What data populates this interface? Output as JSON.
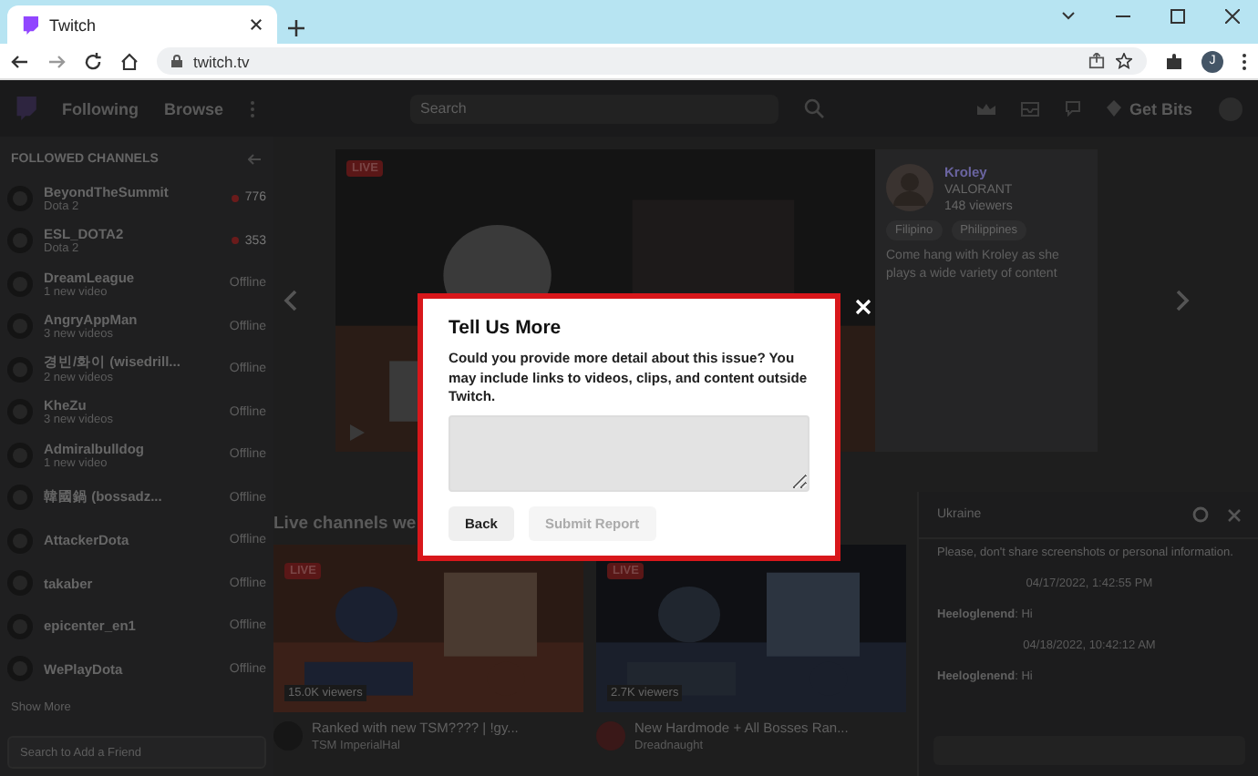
{
  "browser": {
    "tab_title": "Twitch",
    "url": "twitch.tv",
    "avatar_letter": "J"
  },
  "nav": {
    "links": [
      "Following",
      "Browse"
    ],
    "search_placeholder": "Search",
    "get_bits": "Get Bits"
  },
  "sidebar": {
    "heading": "FOLLOWED CHANNELS",
    "channels": [
      {
        "name": "BeyondTheSummit",
        "subtitle": "Dota 2",
        "status": "776",
        "live": true
      },
      {
        "name": "ESL_DOTA2",
        "subtitle": "Dota 2",
        "status": "353",
        "live": true
      },
      {
        "name": "DreamLeague",
        "subtitle": "1 new video",
        "status": "Offline",
        "live": false
      },
      {
        "name": "AngryAppMan",
        "subtitle": "3 new videos",
        "status": "Offline",
        "live": false
      },
      {
        "name": "경빈/화이 (wisedrill...",
        "subtitle": "2 new videos",
        "status": "Offline",
        "live": false
      },
      {
        "name": "KheZu",
        "subtitle": "3 new videos",
        "status": "Offline",
        "live": false
      },
      {
        "name": "Admiralbulldog",
        "subtitle": "1 new video",
        "status": "Offline",
        "live": false
      },
      {
        "name": "韓國鍋 (bossadz...",
        "status": "Offline",
        "live": false
      },
      {
        "name": "AttackerDota",
        "status": "Offline",
        "live": false
      },
      {
        "name": "takaber",
        "status": "Offline",
        "live": false
      },
      {
        "name": "epicenter_en1",
        "status": "Offline",
        "live": false
      },
      {
        "name": "WePlayDota",
        "status": "Offline",
        "live": false
      }
    ],
    "show_more": "Show More",
    "friend_search_placeholder": "Search to Add a Friend"
  },
  "featured": {
    "live_badge": "LIVE",
    "channel": "Kroley",
    "category": "VALORANT",
    "viewers": "148 viewers",
    "tags": [
      "Filipino",
      "Philippines"
    ],
    "description": "Come hang with Kroley as she plays a wide variety of content"
  },
  "section_title": "Live channels we",
  "cards": [
    {
      "badge": "LIVE",
      "viewers": "15.0K viewers",
      "title": "Ranked with new TSM???? | !gy...",
      "channel": "TSM ImperialHal"
    },
    {
      "badge": "LIVE",
      "viewers": "2.7K viewers",
      "title": "New Hardmode + All Bosses Ran...",
      "channel": "Dreadnaught"
    }
  ],
  "chat": {
    "title": "Ukraine",
    "notice": "Please, don't share screenshots or personal information.",
    "messages": [
      {
        "kind": "timestamp",
        "text": "04/17/2022, 1:42:55 PM"
      },
      {
        "kind": "message",
        "text": "**Heeloglenend**: Hi"
      },
      {
        "kind": "timestamp",
        "text": "04/18/2022, 10:42:12 AM"
      },
      {
        "kind": "message",
        "text": "**Heeloglenend**: Hi"
      }
    ]
  },
  "modal": {
    "title": "Tell Us More",
    "body": "Could you provide more detail about this issue? You may include links to videos, clips, and content outside Twitch.",
    "buttons": [
      {
        "label": "Back",
        "disabled": false
      },
      {
        "label": "Submit Report",
        "disabled": true
      }
    ]
  }
}
